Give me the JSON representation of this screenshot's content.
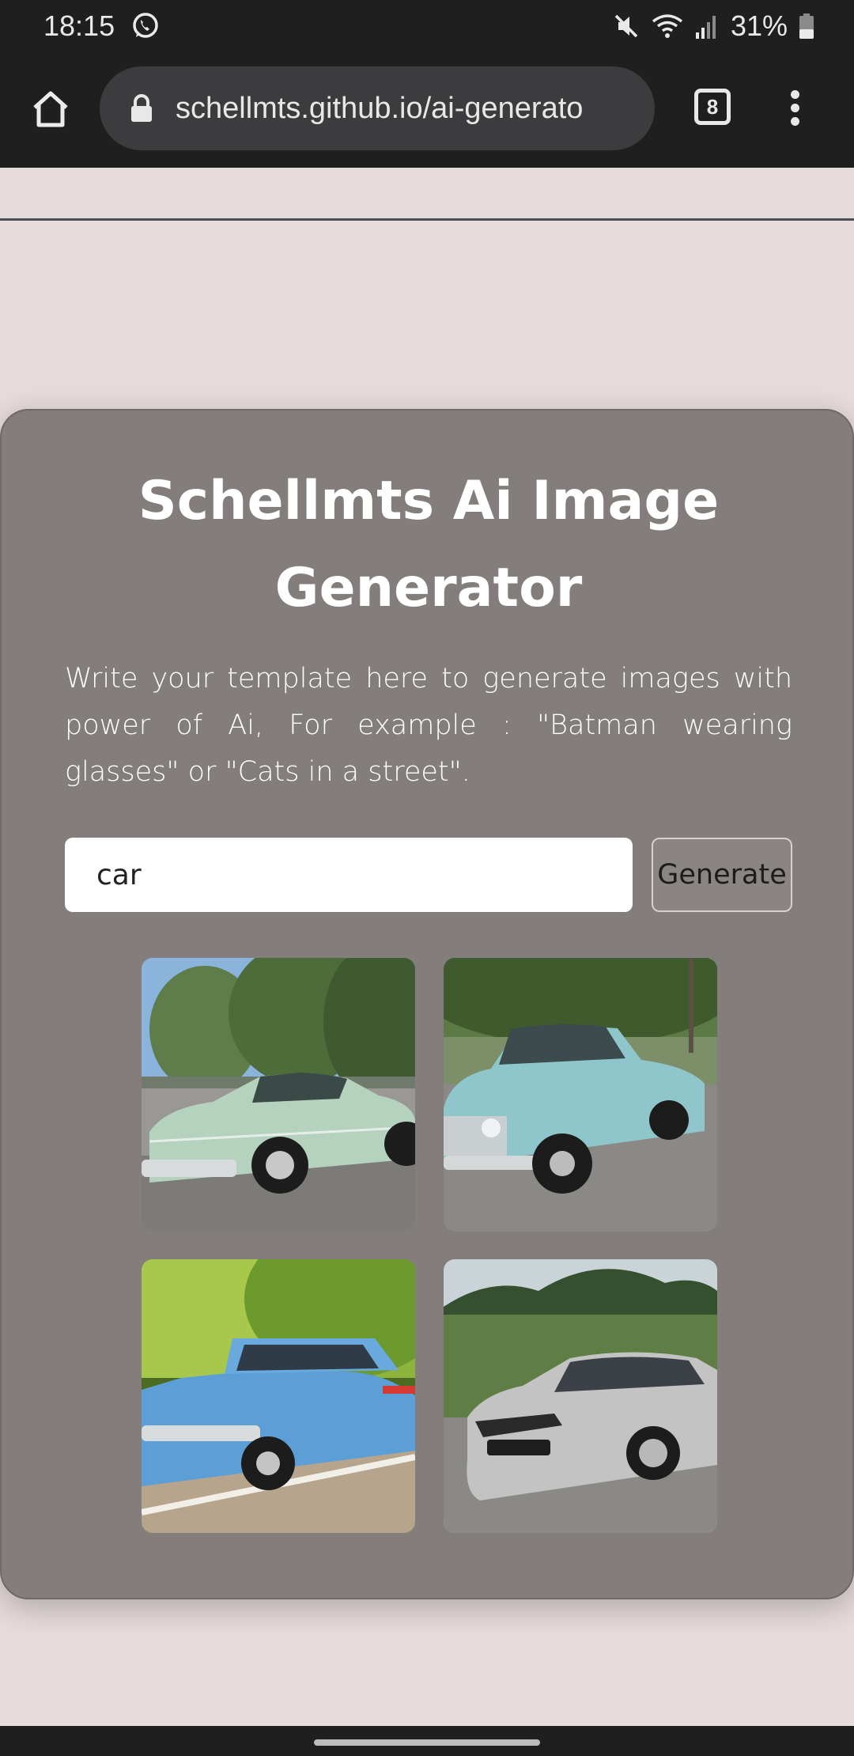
{
  "status_bar": {
    "time": "18:15",
    "battery": "31%",
    "icons": [
      "whatsapp-icon",
      "mute-icon",
      "wifi-icon",
      "signal-icon",
      "battery-icon"
    ]
  },
  "browser": {
    "url": "schellmts.github.io/ai-generato",
    "tab_count": "8",
    "icons": [
      "home-icon",
      "lock-icon",
      "tabs-icon",
      "more-menu-icon"
    ]
  },
  "card": {
    "title": "Schellmts Ai Image Generator",
    "description": "Write your template here to generate images with power of Ai, For example : \"Batman wearing glasses\" or \"Cats in a street\".",
    "prompt_value": "car",
    "generate_label": "Generate"
  },
  "images": [
    {
      "subject": "mint green vintage sedan"
    },
    {
      "subject": "light blue vintage sedan"
    },
    {
      "subject": "blue vintage station wagon"
    },
    {
      "subject": "silver modern sedan"
    }
  ],
  "colors": {
    "page_background": "#e6dcdb",
    "card_background": "#837d7b",
    "system_bar": "#1f1f20",
    "url_bar": "#3c3c3e"
  }
}
